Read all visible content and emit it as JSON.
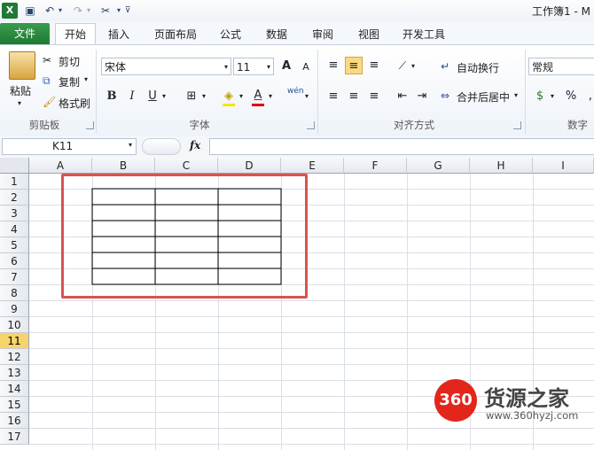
{
  "app": {
    "title": "工作簿1 - M"
  },
  "qat": {
    "undo": "↶",
    "redo": "↷"
  },
  "tabs": [
    "文件",
    "开始",
    "插入",
    "页面布局",
    "公式",
    "数据",
    "审阅",
    "视图",
    "开发工具"
  ],
  "clipboard": {
    "paste": "粘贴",
    "cut": "剪切",
    "copy": "复制",
    "format_painter": "格式刷",
    "group": "剪贴板"
  },
  "font": {
    "name": "宋体",
    "size": "11",
    "bold": "B",
    "italic": "I",
    "underline": "U",
    "grow": "A",
    "shrink": "A",
    "group": "字体",
    "font_color_letter": "A",
    "phonetic": "wén"
  },
  "alignment": {
    "wrap_text": "自动换行",
    "merge_center": "合并后居中",
    "group": "对齐方式"
  },
  "number": {
    "format": "常规",
    "percent": "%",
    "comma": ",",
    "group": "数字"
  },
  "formula_bar": {
    "name_box": "K11",
    "fx": "fx"
  },
  "grid": {
    "columns": [
      "A",
      "B",
      "C",
      "D",
      "E",
      "F",
      "G",
      "H",
      "I"
    ],
    "rows": [
      "1",
      "2",
      "3",
      "4",
      "5",
      "6",
      "7",
      "8",
      "9",
      "10",
      "11",
      "12",
      "13",
      "14",
      "15",
      "16",
      "17"
    ],
    "selected_row": "11"
  },
  "watermark": {
    "badge": "360",
    "brand": "货源之家",
    "url": "www.360hyzj.com"
  },
  "colors": {
    "file_tab": "#2b8a3e",
    "highlight_box": "#d9534f",
    "selected_row": "#f7d36a",
    "badge": "#e3261b"
  }
}
